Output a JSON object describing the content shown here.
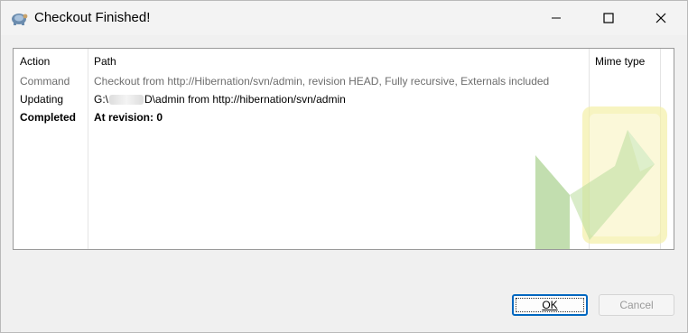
{
  "window": {
    "title": "Checkout Finished!",
    "controls": {
      "minimize_icon": "minimize-icon",
      "maximize_icon": "maximize-icon",
      "close_icon": "close-icon"
    }
  },
  "list": {
    "columns": [
      "Action",
      "Path",
      "Mime type"
    ],
    "rows": [
      {
        "action": "Command",
        "path": "Checkout from http://Hibernation/svn/admin, revision HEAD, Fully recursive, Externals included",
        "style": "gray"
      },
      {
        "action": "Updating",
        "path_prefix": "G:\\",
        "path_suffix": "D\\admin from http://hibernation/svn/admin",
        "style": "normal"
      },
      {
        "action": "Completed",
        "path": "At revision: 0",
        "style": "bold"
      }
    ]
  },
  "buttons": {
    "ok": "OK",
    "cancel": "Cancel"
  },
  "colors": {
    "accent": "#0067c0",
    "watermark_green": "#8fc36e",
    "watermark_yellow": "#f3f0a6"
  }
}
